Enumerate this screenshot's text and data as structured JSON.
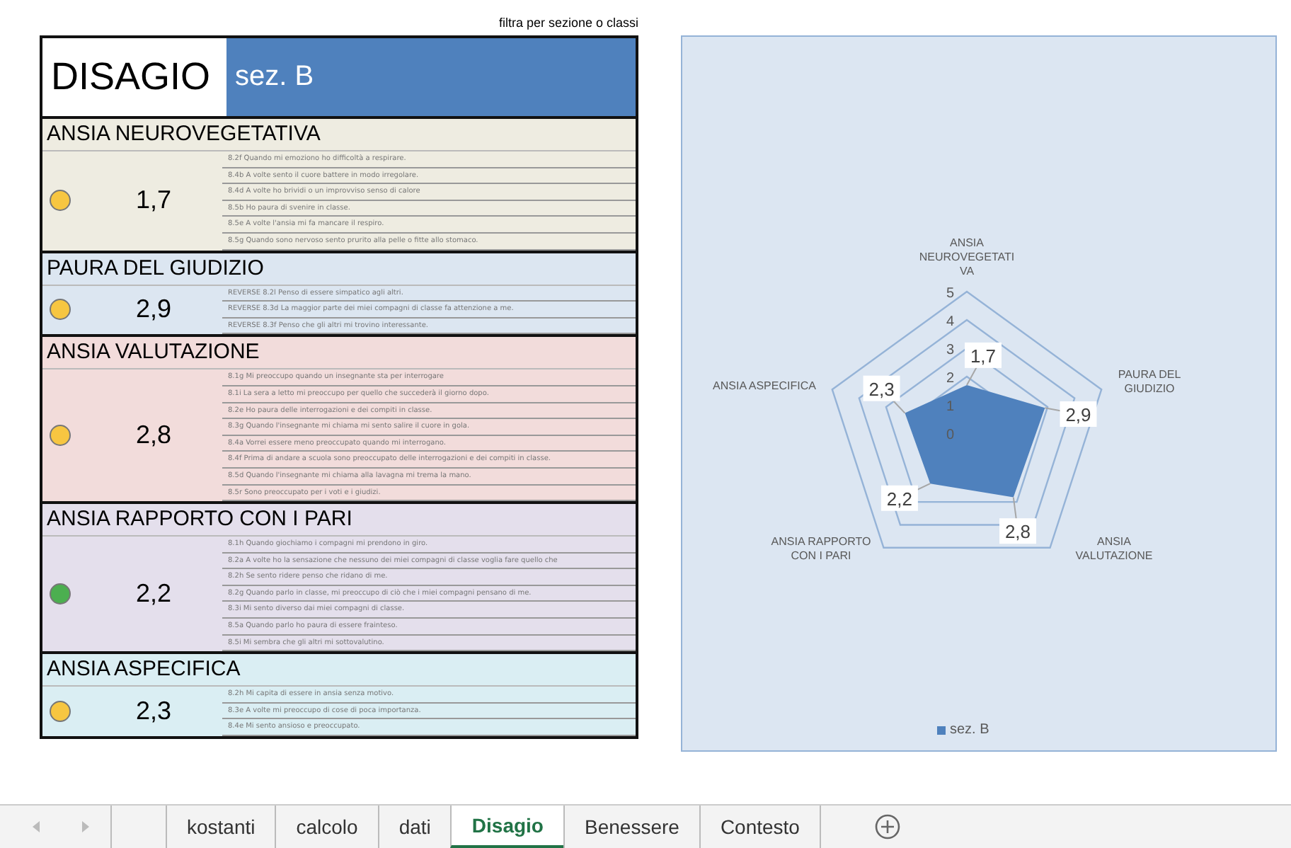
{
  "filter_note": "filtra per sezione o classi",
  "header": {
    "title": "DISAGIO",
    "section": "sez. B"
  },
  "sections": [
    {
      "title": "ANSIA NEUROVEGETATIVA",
      "value": "1,7",
      "color": "#f7c641",
      "items": [
        "8.2f Quando mi emoziono ho difficoltà a respirare.",
        "8.4b A volte sento il cuore battere in modo irregolare.",
        "8.4d A volte ho brividi o un improvviso senso di calore",
        "8.5b Ho paura di svenire in classe.",
        "8.5e A volte l'ansia mi fa mancare il respiro.",
        "8.5g Quando sono nervoso sento prurito alla pelle o fitte allo stomaco."
      ]
    },
    {
      "title": "PAURA DEL GIUDIZIO",
      "value": "2,9",
      "color": "#f7c641",
      "items": [
        "REVERSE 8.2l Penso di essere simpatico agli altri.",
        "REVERSE 8.3d La maggior parte dei miei compagni di classe fa attenzione a me.",
        "REVERSE 8.3f Penso che gli altri mi trovino interessante."
      ]
    },
    {
      "title": "ANSIA VALUTAZIONE",
      "value": "2,8",
      "color": "#f7c641",
      "items": [
        "8.1g Mi preoccupo quando un insegnante sta per interrogare",
        "8.1i La sera a letto mi preoccupo per quello che succederà il giorno dopo.",
        "8.2e Ho paura delle interrogazioni e dei compiti in classe.",
        "8.3g Quando l'insegnante mi chiama mi sento salire il cuore in gola.",
        "8.4a Vorrei essere meno preoccupato quando mi interrogano.",
        "8.4f Prima di andare a scuola sono preoccupato delle interrogazioni e dei compiti in classe.",
        "8.5d Quando l'insegnante mi chiama alla lavagna mi trema la mano.",
        "8.5r Sono preoccupato per i voti e i giudizi."
      ]
    },
    {
      "title": "ANSIA RAPPORTO CON I PARI",
      "value": "2,2",
      "color": "#4caf50",
      "items": [
        "8.1h Quando giochiamo i compagni mi prendono in giro.",
        "8.2a A volte ho la sensazione che nessuno dei miei compagni di classe voglia fare quello che",
        "8.2h Se sento ridere penso che ridano di me.",
        "8.2g Quando parlo in classe, mi preoccupo di ciò che i miei compagni pensano di me.",
        "8.3i Mi sento diverso dai miei compagni di classe.",
        "8.5a Quando parlo ho paura di essere frainteso.",
        "8.5i Mi sembra che gli altri mi sottovalutino."
      ]
    },
    {
      "title": "ANSIA ASPECIFICA",
      "value": "2,3",
      "color": "#f7c641",
      "items": [
        "8.2h Mi capita di essere in ansia senza motivo.",
        "8.3e A volte mi preoccupo di cose di poca importanza.",
        "8.4e Mi sento ansioso e preoccupato."
      ]
    }
  ],
  "radar": {
    "scale_labels": [
      "5",
      "4",
      "3",
      "2",
      "1",
      "0"
    ],
    "legend": "sez. B",
    "axes": [
      {
        "label": "ANSIA NEUROVEGETATIVA",
        "kind": "top",
        "value_label": "1,7"
      },
      {
        "label": "ANSIA ASPECIFICA",
        "kind": "left",
        "value_label": "2,3"
      },
      {
        "label": "PAURA DEL GIUDIZIO",
        "kind": "right",
        "value_label": "2,9"
      },
      {
        "label": "ANSIA RAPPORTO CON I PARI",
        "kind": "lowerleft",
        "value_label": "2,2"
      },
      {
        "label": "ANSIA VALUTAZIONE",
        "kind": "lowerright",
        "value_label": "2,8"
      }
    ]
  },
  "sheet_tabs": [
    {
      "label": "kostanti",
      "selected": false
    },
    {
      "label": "calcolo",
      "selected": false
    },
    {
      "label": "dati",
      "selected": false
    },
    {
      "label": "Disagio",
      "selected": true
    },
    {
      "label": "Benessere",
      "selected": false
    },
    {
      "label": "Contesto",
      "selected": false
    }
  ]
}
